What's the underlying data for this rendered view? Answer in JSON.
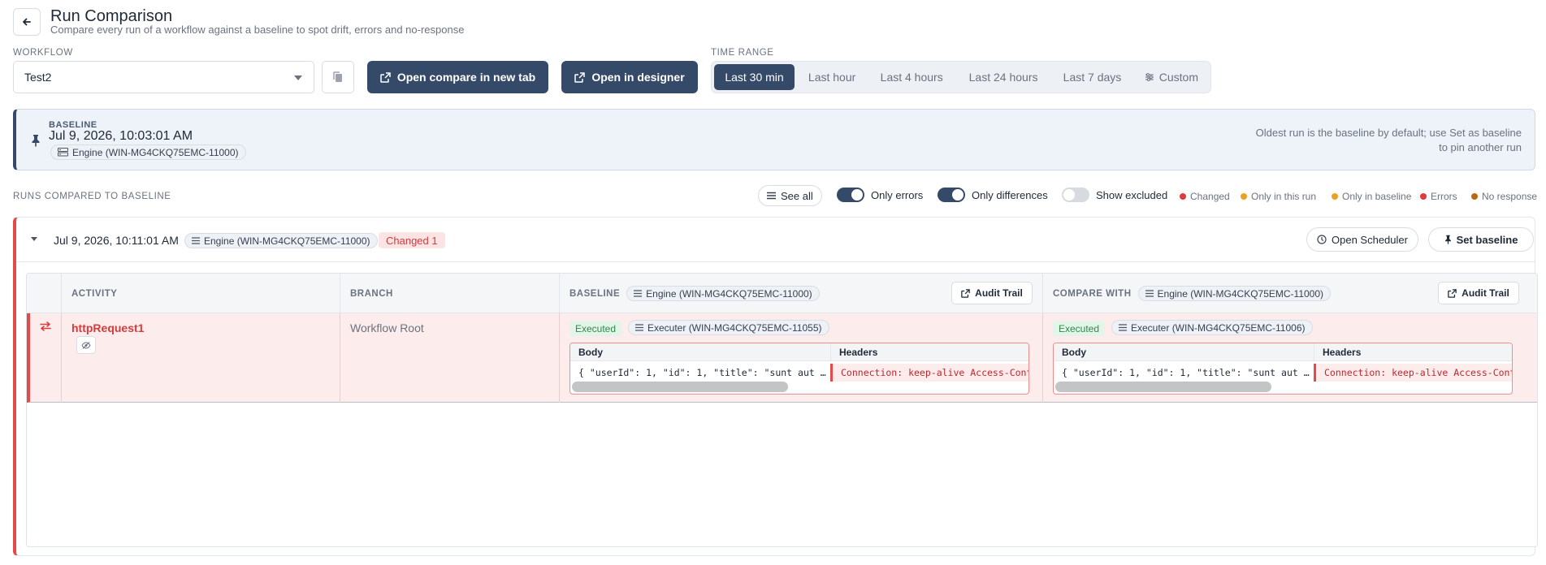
{
  "header": {
    "title": "Run Comparison",
    "subtitle": "Compare every run of a workflow against a baseline to spot drift, errors and no-response"
  },
  "workflow": {
    "label": "WORKFLOW",
    "selected": "Test2"
  },
  "actions": {
    "open_compare": "Open compare in new tab",
    "open_designer": "Open in designer"
  },
  "time_range": {
    "label": "TIME RANGE",
    "options": [
      "Last 30 min",
      "Last hour",
      "Last 4 hours",
      "Last 24 hours",
      "Last 7 days",
      "Custom"
    ],
    "active": "Last 30 min"
  },
  "baseline": {
    "label": "BASELINE",
    "date": "Jul 9, 2026, 10:03:01 AM",
    "engine": "Engine (WIN-MG4CKQ75EMC-11000)",
    "note": "Oldest run is the baseline by default; use Set as baseline to pin another run"
  },
  "runs_toolbar": {
    "label": "RUNS COMPARED TO BASELINE",
    "see_all": "See all",
    "only_errors": {
      "label": "Only errors",
      "on": true
    },
    "only_differences": {
      "label": "Only differences",
      "on": true
    },
    "show_excluded": {
      "label": "Show excluded",
      "on": false
    },
    "legend": [
      {
        "label": "Changed",
        "color": "#e03b3b"
      },
      {
        "label": "Only in this run",
        "color": "#f0a020"
      },
      {
        "label": "Only in baseline",
        "color": "#f0a020"
      },
      {
        "label": "Errors",
        "color": "#e03b3b"
      },
      {
        "label": "No response",
        "color": "#b86a10"
      }
    ]
  },
  "run": {
    "date": "Jul 9, 2026, 10:11:01 AM",
    "engine": "Engine (WIN-MG4CKQ75EMC-11000)",
    "badge": "Changed 1",
    "open_scheduler": "Open Scheduler",
    "set_baseline": "Set baseline",
    "table": {
      "columns": {
        "activity": "ACTIVITY",
        "branch": "BRANCH",
        "baseline": "BASELINE",
        "compare_with": "COMPARE WITH"
      },
      "baseline_engine": "Engine (WIN-MG4CKQ75EMC-11000)",
      "compare_engine": "Engine (WIN-MG4CKQ75EMC-11000)",
      "audit_trail": "Audit Trail",
      "rows": [
        {
          "activity": "httpRequest1",
          "branch": "Workflow Root",
          "baseline": {
            "status": "Executed",
            "executer": "Executer (WIN-MG4CKQ75EMC-11055)",
            "body_label": "Body",
            "body": "{ \"userId\": 1, \"id\": 1, \"title\": \"sunt aut …",
            "headers_label": "Headers",
            "headers": "Connection: keep-alive Access-Contro"
          },
          "compare": {
            "status": "Executed",
            "executer": "Executer (WIN-MG4CKQ75EMC-11006)",
            "body_label": "Body",
            "body": "{ \"userId\": 1, \"id\": 1, \"title\": \"sunt aut …",
            "headers_label": "Headers",
            "headers": "Connection: keep-alive Access-Contro"
          }
        }
      ]
    }
  }
}
